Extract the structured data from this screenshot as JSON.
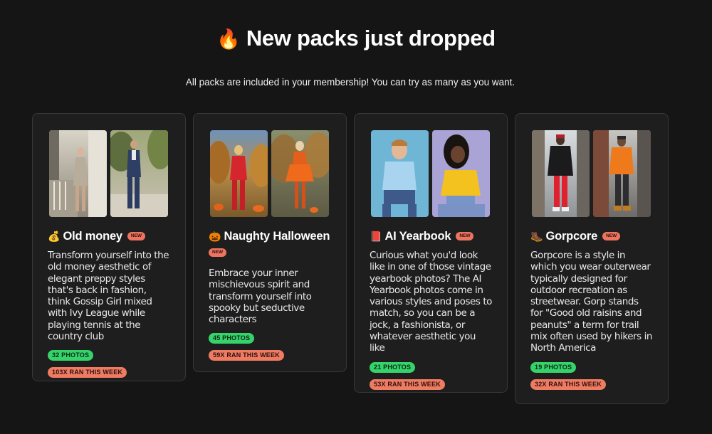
{
  "header": {
    "title": "New packs just dropped",
    "title_icon": "fire-icon",
    "subtitle": "All packs are included in your membership! You can try as many as you want."
  },
  "colors": {
    "background": "#151516",
    "card": "#1e1e1f",
    "new_badge": "#ee7460",
    "photos_badge": "#36d36b",
    "ran_badge": "#ef7b62"
  },
  "packs": [
    {
      "icon": "money-bag-icon",
      "title": "Old money",
      "badge": "NEW",
      "description": "Transform yourself into the old money aesthetic of elegant preppy styles that's back in fashion, think Gossip Girl mixed with Ivy League while playing tennis at the country club",
      "photos": "32 PHOTOS",
      "ran": "103X RAN THIS WEEK"
    },
    {
      "icon": "jack-o-lantern-icon",
      "title": "Naughty Halloween",
      "badge": "NEW",
      "description": "Embrace your inner mischievous spirit and transform yourself into spooky but seductive characters",
      "photos": "45 PHOTOS",
      "ran": "59X RAN THIS WEEK"
    },
    {
      "icon": "red-book-icon",
      "title": "AI Yearbook",
      "badge": "NEW",
      "description": "Curious what you'd look like in one of those vintage yearbook photos? The AI Yearbook photos come in various styles and poses to match, so you can be a jock, a fashionista, or whatever aesthetic you like",
      "photos": "21 PHOTOS",
      "ran": "53X RAN THIS WEEK"
    },
    {
      "icon": "hiking-boot-icon",
      "title": "Gorpcore",
      "badge": "NEW",
      "description": "Gorpcore is a style in which you wear outerwear typically designed for outdoor recreation as streetwear. Gorp stands for \"Good old raisins and peanuts\" a term for trail mix often used by hikers in North America",
      "photos": "19 PHOTOS",
      "ran": "32X RAN THIS WEEK"
    }
  ]
}
